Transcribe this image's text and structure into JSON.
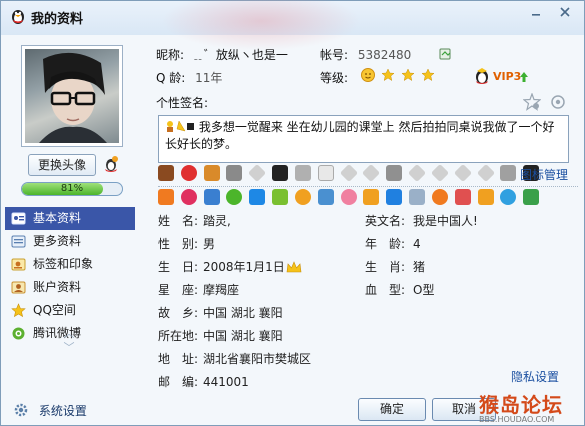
{
  "window": {
    "title": "我的资料"
  },
  "left": {
    "change_avatar_label": "更换头像",
    "progress_text": "81%",
    "progress_value": 0.81,
    "nav": [
      {
        "label": "基本资料",
        "icon": "id-card-icon",
        "active": true
      },
      {
        "label": "更多资料",
        "icon": "list-icon",
        "active": false
      },
      {
        "label": "标签和印象",
        "icon": "tag-icon",
        "active": false
      },
      {
        "label": "账户资料",
        "icon": "account-icon",
        "active": false
      },
      {
        "label": "QQ空间",
        "icon": "qzone-star-icon",
        "active": false
      },
      {
        "label": "腾讯微博",
        "icon": "weibo-icon",
        "active": false
      }
    ]
  },
  "profile": {
    "nickname_label": "昵称:",
    "nickname_value": "﹎゛放纵ヽ也是一",
    "account_label": "帐号:",
    "account_value": "5382480",
    "qage_label": "Q 龄:",
    "qage_value": "11年",
    "level_label": "等级:",
    "vip_label": "VIP3",
    "signature_label": "个性签名:",
    "signature_text": "我多想一觉醒来 坐在幼儿园的课堂上 然后拍拍同桌说我做了一个好长好长的梦。",
    "icon_manage_label": "图标管理"
  },
  "details": {
    "name_k": "姓　名:",
    "name_v": "踏灵,",
    "en_k": "英文名:",
    "en_v": "我是中国人!",
    "gender_k": "性　别:",
    "gender_v": "男",
    "age_k": "年　龄:",
    "age_v": "4",
    "birth_k": "生　日:",
    "birth_v": "2008年1月1日",
    "zodiac_k": "生　肖:",
    "zodiac_v": "猪",
    "star_k": "星　座:",
    "star_v": "摩羯座",
    "blood_k": "血　型:",
    "blood_v": "O型",
    "home_k": "故　乡:",
    "home_v": "中国  湖北  襄阳",
    "loc_k": "所在地:",
    "loc_v": "中国  湖北  襄阳",
    "addr_k": "地　址:",
    "addr_v": "湖北省襄阳市樊城区",
    "zip_k": "邮　编:",
    "zip_v": "441001"
  },
  "footer": {
    "settings_label": "系统设置",
    "privacy_label": "隐私设置",
    "ok_label": "确定",
    "cancel_label": "取消"
  },
  "watermark": {
    "main": "猴岛论坛",
    "sub": "BBS.HOUDAO.COM"
  },
  "colors": {
    "nav_active": "#3a56a8",
    "link": "#1a4fa0",
    "progress": "#4cb52b"
  }
}
